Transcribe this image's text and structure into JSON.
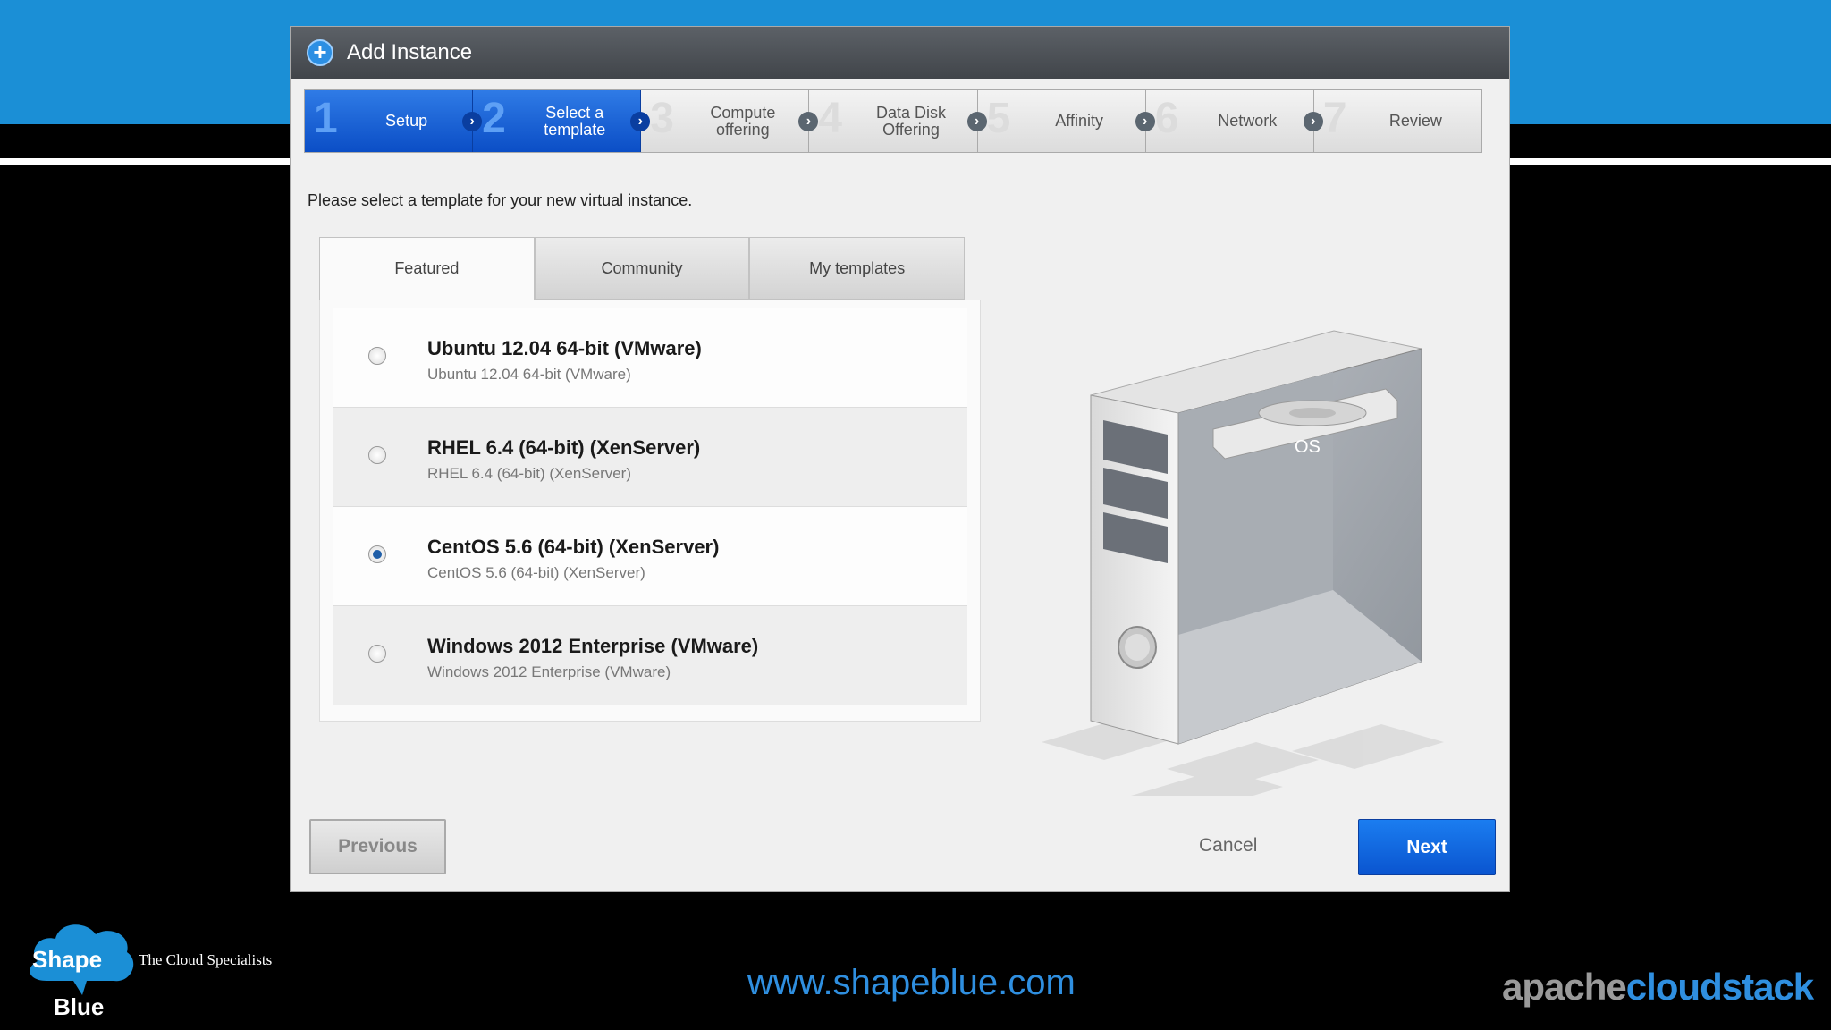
{
  "dialog": {
    "title": "Add Instance",
    "icon": "plus-circle-icon"
  },
  "steps": [
    {
      "number": "1",
      "label": "Setup",
      "active": true
    },
    {
      "number": "2",
      "label": "Select a template",
      "active": true
    },
    {
      "number": "3",
      "label": "Compute offering",
      "active": false
    },
    {
      "number": "4",
      "label": "Data Disk Offering",
      "active": false
    },
    {
      "number": "5",
      "label": "Affinity",
      "active": false
    },
    {
      "number": "6",
      "label": "Network",
      "active": false
    },
    {
      "number": "7",
      "label": "Review",
      "active": false
    }
  ],
  "instructions": "Please select a template for your new virtual instance.",
  "tabs": [
    {
      "label": "Featured",
      "active": true
    },
    {
      "label": "Community",
      "active": false
    },
    {
      "label": "My templates",
      "active": false
    }
  ],
  "templates": [
    {
      "name": "Ubuntu 12.04 64-bit (VMware)",
      "description": "Ubuntu 12.04 64-bit (VMware)",
      "selected": false
    },
    {
      "name": "RHEL 6.4 (64-bit) (XenServer)",
      "description": "RHEL 6.4 (64-bit) (XenServer)",
      "selected": false
    },
    {
      "name": "CentOS 5.6 (64-bit) (XenServer)",
      "description": "CentOS 5.6 (64-bit) (XenServer)",
      "selected": true
    },
    {
      "name": "Windows 2012 Enterprise (VMware)",
      "description": "Windows 2012 Enterprise (VMware)",
      "selected": false
    }
  ],
  "illustration": {
    "os_label": "OS"
  },
  "buttons": {
    "previous": "Previous",
    "cancel": "Cancel",
    "next": "Next"
  },
  "branding": {
    "logo_line1": "Shape",
    "logo_line2": "Blue",
    "tagline": "The Cloud Specialists",
    "website": "www.shapeblue.com",
    "acs_part1": "apache",
    "acs_part2": "cloudstack"
  },
  "colors": {
    "accent": "#1b8fd6",
    "active_step": "#0b4ec6",
    "next_button": "#0a55d0"
  }
}
